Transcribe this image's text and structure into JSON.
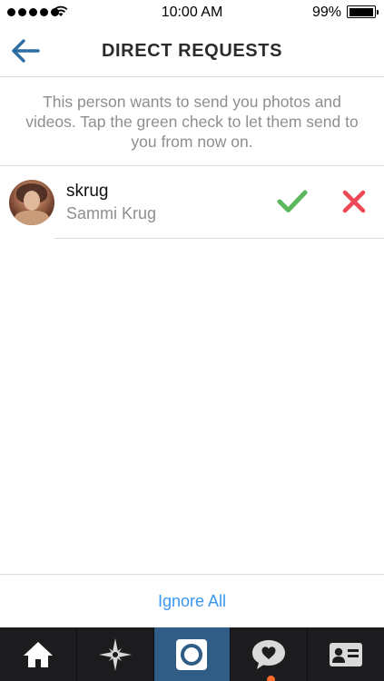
{
  "status_bar": {
    "time": "10:00 AM",
    "battery": "99%",
    "signal_icon": "signal-dots-icon",
    "wifi_icon": "wifi-icon",
    "battery_icon": "battery-icon"
  },
  "header": {
    "title": "DIRECT REQUESTS",
    "back_icon": "back-arrow-icon"
  },
  "info": {
    "text": "This person wants to send you photos and videos. Tap the green check to let them send to you from now on."
  },
  "requests": [
    {
      "username": "skrug",
      "full_name": "Sammi Krug",
      "accept_icon": "checkmark-icon",
      "decline_icon": "x-icon"
    }
  ],
  "footer": {
    "ignore_all_label": "Ignore All"
  },
  "tab_bar": {
    "tabs": [
      {
        "icon": "home-icon",
        "active": false
      },
      {
        "icon": "explore-icon",
        "active": false
      },
      {
        "icon": "camera-icon",
        "active": true
      },
      {
        "icon": "activity-heart-icon",
        "active": false,
        "has_notification": true
      },
      {
        "icon": "profile-icon",
        "active": false
      }
    ]
  },
  "colors": {
    "accent_blue": "#3897f0",
    "accept_green": "#5cb85c",
    "decline_red": "#ed4956",
    "back_arrow_blue": "#2f6da3",
    "tab_bar_bg": "#1c1c1e",
    "tab_active_bg": "#2f5d86",
    "notification_orange": "#ff6a2a"
  }
}
